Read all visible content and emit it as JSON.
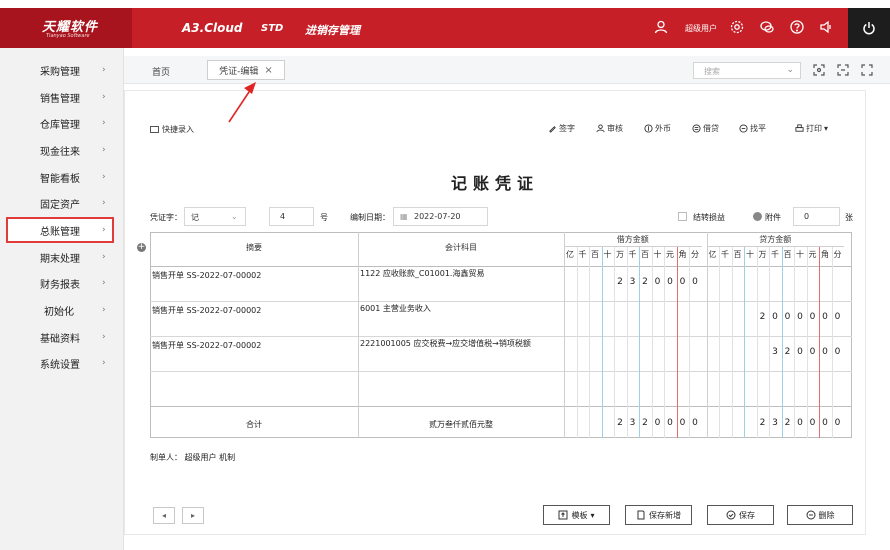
{
  "header": {
    "logo": "天耀软件",
    "logo_sub": "Tianyao Software",
    "product": "A3.Cloud",
    "edition": "STD",
    "module": "进销存管理",
    "user": "超级用户"
  },
  "sidebar": {
    "items": [
      {
        "label": "采购管理"
      },
      {
        "label": "销售管理"
      },
      {
        "label": "仓库管理"
      },
      {
        "label": "现金往来"
      },
      {
        "label": "智能看板"
      },
      {
        "label": "固定资产"
      },
      {
        "label": "总账管理"
      },
      {
        "label": "期末处理"
      },
      {
        "label": "财务报表"
      },
      {
        "label": "初始化"
      },
      {
        "label": "基础资料"
      },
      {
        "label": "系统设置"
      }
    ],
    "chevron": "›"
  },
  "tabs": {
    "home": "首页",
    "active": "凭证-编辑",
    "close": "×",
    "search_placeholder": "搜索"
  },
  "toolbar": {
    "quick_entry": "快捷录入",
    "actions": [
      "签字",
      "审核",
      "外币",
      "借贷",
      "找平",
      "打印"
    ]
  },
  "voucher": {
    "title": "记账凭证",
    "type_label": "凭证字：",
    "type_value": "记",
    "number": "4",
    "number_suffix": "号",
    "date_label": "编制日期：",
    "date_value": "2022-07-20",
    "carry_forward": "结转损益",
    "attachment_label": "附件",
    "attachment_value": "0",
    "attachment_suffix": "张",
    "col_summary": "摘要",
    "col_account": "会计科目",
    "col_debit": "借方金额",
    "col_credit": "贷方金额",
    "units": [
      "亿",
      "千",
      "百",
      "十",
      "万",
      "千",
      "百",
      "十",
      "元",
      "角",
      "分"
    ],
    "rows": [
      {
        "summary": "销售开单 SS-2022-07-00002",
        "account": "1122 应收账款_C01001.海鑫贸易",
        "debit": "2320000",
        "credit": ""
      },
      {
        "summary": "销售开单 SS-2022-07-00002",
        "account": "6001 主营业务收入",
        "debit": "",
        "credit": "2000000"
      },
      {
        "summary": "销售开单 SS-2022-07-00002",
        "account": "2221001005 应交税费→应交增值税→销项税额",
        "debit": "",
        "credit": "320000"
      },
      {
        "summary": "",
        "account": "",
        "debit": "",
        "credit": ""
      }
    ],
    "total_label": "合计",
    "total_words": "贰万叁仟贰佰元整",
    "total_debit": "2320000",
    "total_credit": "2320000",
    "maker": "制单人： 超级用户 机制"
  },
  "buttons": {
    "prev": "◂",
    "next": "▸",
    "template": "模板",
    "save_new": "保存新增",
    "save": "保存",
    "delete": "删除"
  },
  "colors": {
    "brand": "#c71f27",
    "highlight": "#e03c3c"
  }
}
